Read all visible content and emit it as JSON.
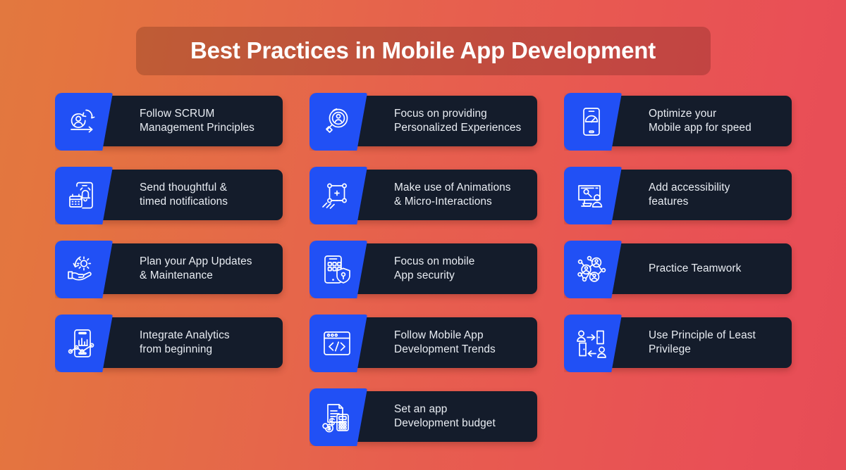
{
  "header": {
    "title": "Best Practices in Mobile App Development"
  },
  "theme": {
    "background_gradient_start": "#e2783f",
    "background_gradient_end": "#e64c55",
    "card_panel_color": "#141c2b",
    "icon_panel_color": "#2150f5",
    "icon_wedge_color": "#15308f",
    "text_color": "#e9edf3",
    "title_bar_overlay": "rgba(60,20,10,0.22)"
  },
  "cards": [
    {
      "id": "scrum",
      "icon": "scrum-cycle-icon",
      "label": "Follow SCRUM\nManagement Principles"
    },
    {
      "id": "personalized",
      "icon": "magnifier-person-icon",
      "label": "Focus on providing\nPersonalized Experiences"
    },
    {
      "id": "speed",
      "icon": "phone-speedometer-icon",
      "label": "Optimize your\nMobile app for speed"
    },
    {
      "id": "notifications",
      "icon": "phone-bell-calendar-icon",
      "label": "Send thoughtful &\ntimed notifications"
    },
    {
      "id": "animations",
      "icon": "animation-nodes-icon",
      "label": "Make use of Animations\n& Micro-Interactions"
    },
    {
      "id": "accessibility",
      "icon": "monitor-accessibility-icon",
      "label": "Add accessibility\nfeatures"
    },
    {
      "id": "updates",
      "icon": "hand-gear-refresh-icon",
      "label": "Plan your App Updates\n& Maintenance"
    },
    {
      "id": "security",
      "icon": "phone-shield-lock-icon",
      "label": "Focus on mobile\nApp security"
    },
    {
      "id": "teamwork",
      "icon": "people-network-icon",
      "label": "Practice Teamwork"
    },
    {
      "id": "analytics",
      "icon": "phone-analytics-icon",
      "label": "Integrate Analytics\nfrom beginning"
    },
    {
      "id": "trends",
      "icon": "browser-code-icon",
      "label": "Follow Mobile App\nDevelopment Trends"
    },
    {
      "id": "least-privilege",
      "icon": "user-access-door-icon",
      "label": "Use Principle of Least\nPrivilege"
    },
    {
      "id": "budget",
      "icon": "invoice-calculator-coins-icon",
      "label": "Set an app\nDevelopment budget"
    }
  ],
  "layout": {
    "rows": [
      [
        "scrum",
        "personalized",
        "speed"
      ],
      [
        "notifications",
        "animations",
        "accessibility"
      ],
      [
        "updates",
        "security",
        "teamwork"
      ],
      [
        "analytics",
        "trends",
        "least-privilege"
      ],
      [
        null,
        "budget",
        null
      ]
    ]
  }
}
